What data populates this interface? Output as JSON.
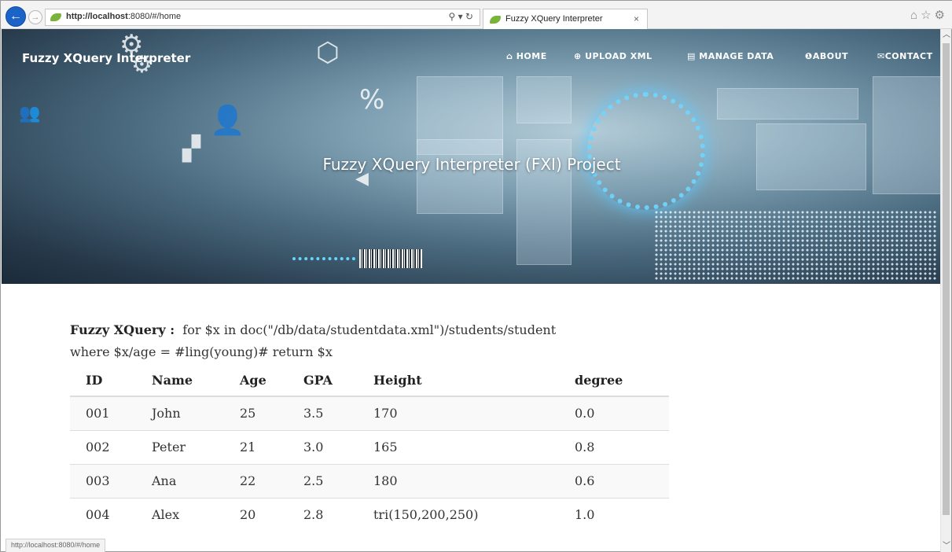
{
  "browser": {
    "url_host": "http://localhost",
    "url_rest": ":8080/#/home",
    "tab_title": "Fuzzy XQuery Interpreter",
    "tab_close": "×",
    "status_url": "http://localhost:8080/#/home"
  },
  "site": {
    "brand": "Fuzzy XQuery Interpreter",
    "nav": [
      {
        "icon": "home-icon",
        "glyph": "⌂",
        "label": "HOME"
      },
      {
        "icon": "upload-icon",
        "glyph": "⊕",
        "label": "UPLOAD XML"
      },
      {
        "icon": "list-icon",
        "glyph": "▤",
        "label": "MANAGE DATA"
      },
      {
        "icon": "info-icon",
        "glyph": "❶",
        "label": "ABOUT"
      },
      {
        "icon": "envelope-icon",
        "glyph": "✉",
        "label": "CONTACT"
      }
    ],
    "headline": "Fuzzy XQuery Interpreter (FXI) Project"
  },
  "query": {
    "label": "Fuzzy XQuery :",
    "text_line1": "for $x in doc(\"/db/data/studentdata.xml\")/students/student",
    "text_line2": "where $x/age = #ling(young)# return $x"
  },
  "table": {
    "columns": [
      "ID",
      "Name",
      "Age",
      "GPA",
      "Height",
      "degree"
    ],
    "rows": [
      [
        "001",
        "John",
        "25",
        "3.5",
        "170",
        "0.0"
      ],
      [
        "002",
        "Peter",
        "21",
        "3.0",
        "165",
        "0.8"
      ],
      [
        "003",
        "Ana",
        "22",
        "2.5",
        "180",
        "0.6"
      ],
      [
        "004",
        "Alex",
        "20",
        "2.8",
        "tri(150,200,250)",
        "1.0"
      ]
    ]
  }
}
